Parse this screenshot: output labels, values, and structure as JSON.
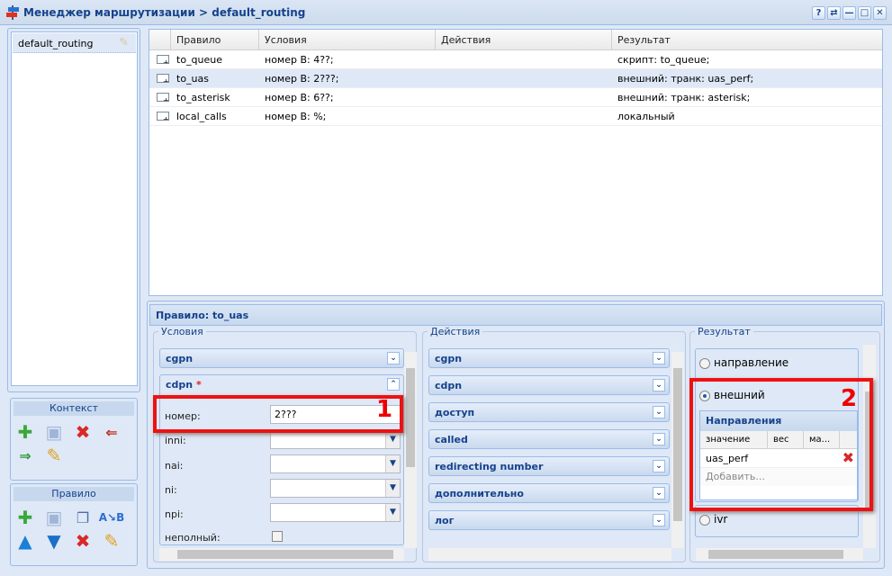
{
  "window": {
    "title": "Менеджер маршрутизации > default_routing",
    "buttons": [
      "?",
      "⇄",
      "—",
      "□",
      "✕"
    ]
  },
  "contexts": {
    "items": [
      "default_routing"
    ]
  },
  "context_toolbar": {
    "title": "Контекст",
    "icons": [
      "add-icon",
      "save-icon",
      "delete-icon",
      "import-icon",
      "export-icon",
      "edit-icon"
    ]
  },
  "rule_toolbar": {
    "title": "Правило",
    "icons": [
      "add-icon",
      "save-icon",
      "copy-icon",
      "rename-icon",
      "move-up-icon",
      "move-down-icon",
      "delete-icon",
      "edit-icon"
    ]
  },
  "grid": {
    "columns": [
      "Правило",
      "Условия",
      "Действия",
      "Результат"
    ],
    "rows": [
      {
        "rule": "to_queue",
        "conditions": "номер B: 4??;",
        "actions": "",
        "result": "скрипт: to_queue;"
      },
      {
        "rule": "to_uas",
        "conditions": "номер B: 2???;",
        "actions": "",
        "result": "внешний: транк: uas_perf;"
      },
      {
        "rule": "to_asterisk",
        "conditions": "номер B: 6??;",
        "actions": "",
        "result": "внешний: транк: asterisk;"
      },
      {
        "rule": "local_calls",
        "conditions": "номер B: %;",
        "actions": "",
        "result": "локальный"
      }
    ]
  },
  "rule_panel": {
    "title": "Правило: to_uas",
    "conditions": {
      "legend": "Условия",
      "sections": [
        "cgpn",
        "cdpn"
      ],
      "required_mark": "*",
      "fields": {
        "number_label": "номер:",
        "number_value": "2???",
        "inni_label": "inni:",
        "nai_label": "nai:",
        "ni_label": "ni:",
        "npi_label": "npi:",
        "incomplete_label": "неполный:"
      }
    },
    "actions": {
      "legend": "Действия",
      "sections": [
        "cgpn",
        "cdpn",
        "доступ",
        "called",
        "redirecting number",
        "дополнительно",
        "лог"
      ]
    },
    "result": {
      "legend": "Результат",
      "options": [
        "направление",
        "внешний",
        "ivr"
      ],
      "selected": "внешний",
      "directions": {
        "title": "Направления",
        "columns": [
          "значение",
          "вес",
          "ма..."
        ],
        "rows": [
          "uas_perf"
        ],
        "add_placeholder": "Добавить..."
      }
    }
  },
  "annotations": [
    "1",
    "2"
  ]
}
